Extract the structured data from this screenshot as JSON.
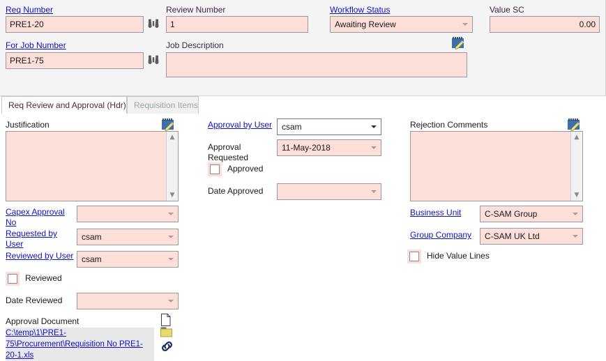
{
  "header": {
    "fields": [
      {
        "label": "Req Number",
        "link": true,
        "value": "PRE1-20",
        "has_lookup": true
      },
      {
        "label": "Review Number",
        "link": false,
        "value": "1",
        "has_lookup": false
      },
      {
        "label": "Workflow Status",
        "link": true,
        "value": "Awaiting Review",
        "type": "dropdown"
      },
      {
        "label": "Value SC",
        "link": false,
        "value": "0.00",
        "align": "right"
      },
      {
        "label": "For Job Number",
        "link": true,
        "value": "PRE1-75",
        "has_lookup": true
      },
      {
        "label": "Job Description",
        "link": false,
        "value": "",
        "has_note": true
      }
    ],
    "lookup_icon": "binoculars-icon",
    "note_icon": "notepad-edit-icon"
  },
  "tabs": [
    {
      "label": "Req Review and Approval (Hdr)",
      "active": true
    },
    {
      "label": "Requisition Items",
      "active": false
    }
  ],
  "left_column": {
    "justification_label": "Justification",
    "justification_value": "",
    "justification_note_icon": "notepad-edit-icon",
    "capex_approval_no_label": "Capex Approval No",
    "capex_approval_no_value": "",
    "requested_by_user_label": "Requested by User",
    "requested_by_user_value": "csam",
    "reviewed_by_user_label": "Reviewed by User",
    "reviewed_by_user_value": "csam",
    "reviewed_checkbox_label": "Reviewed",
    "reviewed_checked": false,
    "date_reviewed_label": "Date Reviewed",
    "date_reviewed_value": "",
    "approval_document_label": "Approval Document",
    "approval_document_path": "C:\\temp\\1\\PRE1-75\\Procurement\\Requisition No PRE1-20-1.xls",
    "doc_icons": [
      "page-icon",
      "folder-icon",
      "link-icon"
    ]
  },
  "middle_column": {
    "approval_by_user_label": "Approval by User",
    "approval_by_user_value": "csam",
    "approval_requested_label": "Approval Requested",
    "approval_requested_value": "11-May-2018",
    "approved_checkbox_label": "Approved",
    "approved_checked": false,
    "date_approved_label": "Date Approved",
    "date_approved_value": ""
  },
  "right_column": {
    "rejection_comments_label": "Rejection Comments",
    "rejection_comments_value": "",
    "rejection_note_icon": "notepad-edit-icon",
    "business_unit_label": "Business Unit",
    "business_unit_value": "C-SAM Group",
    "group_company_label": "Group Company",
    "group_company_value": "C-SAM UK  Ltd",
    "hide_value_lines_label": "Hide Value Lines",
    "hide_value_lines_checked": false
  },
  "colors": {
    "field_bg": "#fbdfd8",
    "link": "#1111cc",
    "header_bg": "#f4f4f4",
    "active_tab_text": "#52243a",
    "inactive_tab_text": "#9aa89a"
  }
}
